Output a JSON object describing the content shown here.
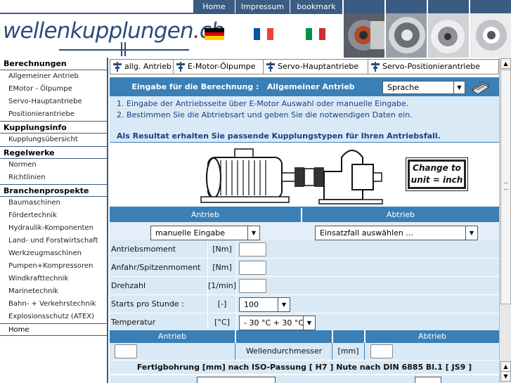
{
  "topnav": [
    "Home",
    "Impressum",
    "bookmark"
  ],
  "logo": {
    "text": "wellenkupplungen.ch"
  },
  "flags": [
    "de",
    "fr",
    "it"
  ],
  "sidebar": [
    {
      "type": "head",
      "label": "Berechnungen"
    },
    {
      "type": "item",
      "label": "Allgemeiner Antrieb"
    },
    {
      "type": "item",
      "label": "EMotor - Ölpumpe"
    },
    {
      "type": "item",
      "label": "Servo-Hauptantriebe"
    },
    {
      "type": "item",
      "label": "Positionierantriebe"
    },
    {
      "type": "head",
      "label": "Kupplungsinfo"
    },
    {
      "type": "item",
      "label": "Kupplungsübersicht"
    },
    {
      "type": "head",
      "label": "Regelwerke"
    },
    {
      "type": "item",
      "label": "Normen"
    },
    {
      "type": "item",
      "label": "Richtlinien"
    },
    {
      "type": "head",
      "label": "Branchenprospekte"
    },
    {
      "type": "item",
      "label": "Baumaschinen"
    },
    {
      "type": "item",
      "label": "Fördertechnik"
    },
    {
      "type": "item",
      "label": "Hydraulik-Komponenten"
    },
    {
      "type": "item",
      "label": "Land- und Forstwirtschaft"
    },
    {
      "type": "item",
      "label": "Werkzeugmaschinen"
    },
    {
      "type": "item",
      "label": "Pumpen+Kompressoren"
    },
    {
      "type": "item",
      "label": "Windkrafttechnik"
    },
    {
      "type": "item",
      "label": "Marinetechnik"
    },
    {
      "type": "item",
      "label": "Bahn- + Verkehrstechnik"
    },
    {
      "type": "item",
      "label": "Explosionsschutz (ATEX)"
    },
    {
      "type": "head",
      "label": "Home",
      "plain": true
    }
  ],
  "tabs": [
    "allg. Antrieb",
    "E-Motor-Ölpumpe",
    "Servo-Hauptantriebe",
    "Servo-Positionierantriebe"
  ],
  "title": {
    "label": "Eingabe für die Berechnung :",
    "value": "Allgemeiner Antrieb",
    "language_select": "Sprache"
  },
  "info": {
    "line1": "1. Eingabe der Antriebsseite über E-Motor Auswahl oder manuelle Eingabe.",
    "line2": "2. Bestimmen Sie die Abtriebsart und geben Sie die notwendigen Daten ein.",
    "result": "Als Resultat erhalten Sie passende Kupplungstypen für Ihren Antriebsfall."
  },
  "unit_box": {
    "line1": "Change to",
    "line2": "unit =  inch"
  },
  "section1": {
    "antrieb": "Antrieb",
    "abtrieb": "Abtrieb",
    "antrieb_select": "manuelle Eingabe",
    "abtrieb_select": "Einsatzfall auswählen ..."
  },
  "params": [
    {
      "label": "Antriebsmoment",
      "unit": "[Nm]"
    },
    {
      "label": "Anfahr/Spitzenmoment",
      "unit": "[Nm]"
    },
    {
      "label": "Drehzahl",
      "unit": "[1/min]"
    },
    {
      "label": "Starts pro Stunde :",
      "unit": "[-]",
      "select": "100"
    },
    {
      "label": "Temperatur",
      "unit": "[°C]",
      "select": "- 30 °C + 30 °C"
    }
  ],
  "section2": {
    "antrieb": "Antrieb",
    "abtrieb": "Abtrieb",
    "shaft_label": "Wellendurchmesser",
    "shaft_unit": "[mm]",
    "bore_text": "Fertigbohrung [mm] nach ISO-Passung [ H7 ] Nute nach DIN 6885 Bl.1 [ JS9 ]"
  }
}
